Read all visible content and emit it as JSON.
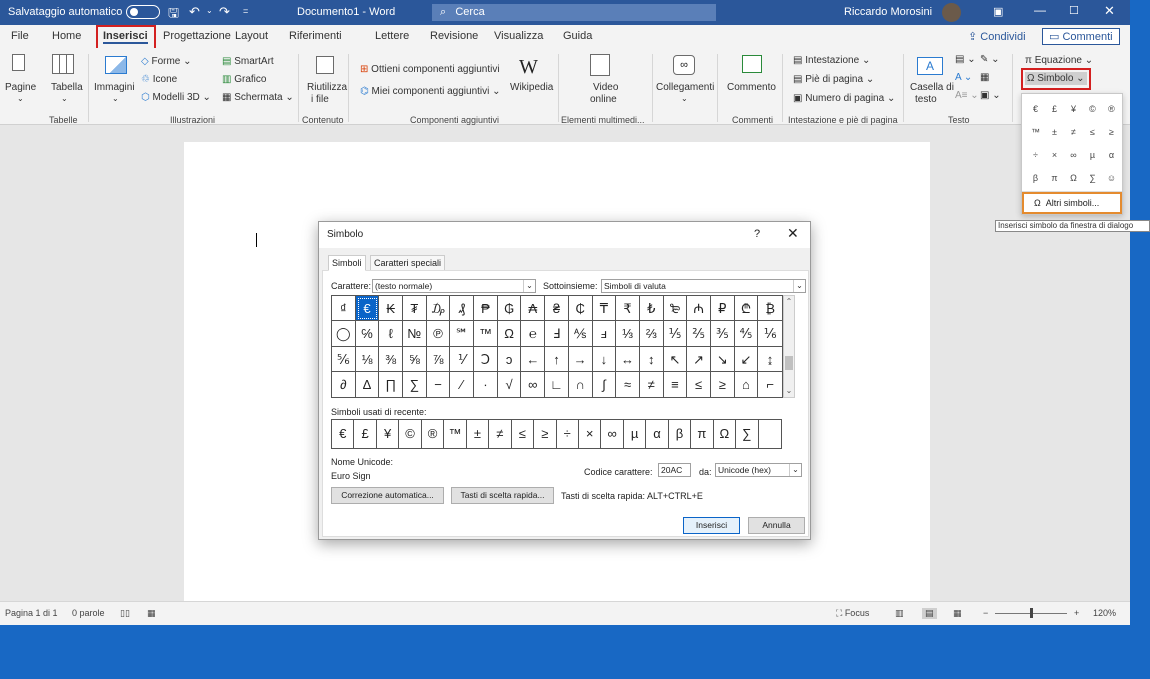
{
  "titlebar": {
    "autosave": "Salvataggio automatico",
    "doc_title": "Documento1 - Word",
    "search": "Cerca",
    "user": "Riccardo Morosini"
  },
  "menu": {
    "tabs": [
      "File",
      "Home",
      "Inserisci",
      "Progettazione",
      "Layout",
      "Riferimenti",
      "Lettere",
      "Revisione",
      "Visualizza",
      "Guida"
    ],
    "share": "Condividi",
    "comments": "Commenti"
  },
  "ribbon": {
    "pagine": "Pagine",
    "tabella": "Tabella",
    "immagini": "Immagini",
    "forme": "Forme",
    "icone": "Icone",
    "modelli3d": "Modelli 3D",
    "smartart": "SmartArt",
    "grafico": "Grafico",
    "schermata": "Schermata",
    "riutilizza": "Riutilizza",
    "ifile": "i file",
    "ottieni": "Ottieni componenti aggiuntivi",
    "miei": "Miei componenti aggiuntivi",
    "wikipedia": "Wikipedia",
    "video": "Video",
    "online": "online",
    "collegamenti": "Collegamenti",
    "commento": "Commento",
    "intestazione": "Intestazione",
    "pie": "Piè di pagina",
    "numero": "Numero di pagina",
    "casella": "Casella di",
    "testo": "testo",
    "equazione": "Equazione",
    "simbolo": "Simbolo",
    "groups": {
      "tabelle": "Tabelle",
      "illustrazioni": "Illustrazioni",
      "contenuto": "Contenuto",
      "componenti": "Componenti aggiuntivi",
      "multimedia": "Elementi multimedi...",
      "commenti": "Commenti",
      "intpie": "Intestazione e piè di pagina",
      "testo": "Testo"
    }
  },
  "symbol_dropdown": {
    "symbols": [
      "€",
      "£",
      "¥",
      "©",
      "®",
      "™",
      "±",
      "≠",
      "≤",
      "≥",
      "÷",
      "×",
      "∞",
      "µ",
      "α",
      "β",
      "π",
      "Ω",
      "∑",
      "☺"
    ],
    "more": "Altri simboli..."
  },
  "tooltip": "Inserisci simbolo da finestra di dialogo",
  "dialog": {
    "title": "Simbolo",
    "help": "?",
    "close": "✕",
    "tabs": [
      "Simboli",
      "Caratteri speciali"
    ],
    "font_label": "Carattere:",
    "font_value": "(testo normale)",
    "subset_label": "Sottoinsieme:",
    "subset_value": "Simboli di valuta",
    "grid": [
      [
        "₫",
        "€",
        "₭",
        "₮",
        "₯",
        "₰",
        "₱",
        "₲",
        "₳",
        "₴",
        "₵",
        "₸",
        "₹",
        "₺",
        "₻",
        "₼",
        "₽",
        "₾",
        "₿"
      ],
      [
        "◯",
        "℅",
        "ℓ",
        "№",
        "℗",
        "℠",
        "™",
        "Ω",
        "℮",
        "Ⅎ",
        "⅍",
        "ⅎ",
        "⅓",
        "⅔",
        "⅕",
        "⅖",
        "⅗",
        "⅘",
        "⅙"
      ],
      [
        "⅚",
        "⅛",
        "⅜",
        "⅝",
        "⅞",
        "⅟",
        "Ↄ",
        "ↄ",
        "←",
        "↑",
        "→",
        "↓",
        "↔",
        "↕",
        "↖",
        "↗",
        "↘",
        "↙",
        "↨"
      ],
      [
        "∂",
        "∆",
        "∏",
        "∑",
        "−",
        "∕",
        "∙",
        "√",
        "∞",
        "∟",
        "∩",
        "∫",
        "≈",
        "≠",
        "≡",
        "≤",
        "≥",
        "⌂",
        "⌐"
      ]
    ],
    "recent_label": "Simboli usati di recente:",
    "recent": [
      "€",
      "£",
      "¥",
      "©",
      "®",
      "™",
      "±",
      "≠",
      "≤",
      "≥",
      "÷",
      "×",
      "∞",
      "µ",
      "α",
      "β",
      "π",
      "Ω",
      "∑"
    ],
    "unicode_name_label": "Nome Unicode:",
    "unicode_name": "Euro Sign",
    "code_label": "Codice carattere:",
    "code_value": "20AC",
    "from_label": "da:",
    "from_value": "Unicode (hex)",
    "autocorrect": "Correzione automatica...",
    "shortcut_btn": "Tasti di scelta rapida...",
    "shortcut_text": "Tasti di scelta rapida: ALT+CTRL+E",
    "insert": "Inserisci",
    "cancel": "Annulla"
  },
  "status": {
    "page": "Pagina 1 di 1",
    "words": "0 parole",
    "focus": "Focus",
    "zoom": "120%",
    "zoom_minus": "−",
    "zoom_plus": "+"
  }
}
